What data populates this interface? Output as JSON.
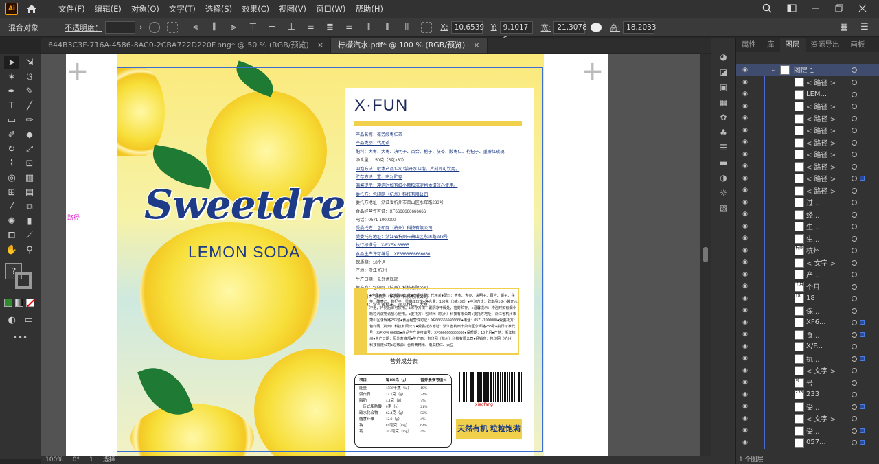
{
  "menu": {
    "logo": "Ai",
    "items": [
      "文件(F)",
      "编辑(E)",
      "对象(O)",
      "文字(T)",
      "选择(S)",
      "效果(C)",
      "视图(V)",
      "窗口(W)",
      "帮助(H)"
    ]
  },
  "control": {
    "object_label": "混合对象",
    "opacity_label": "不透明度：",
    "x_label": "X:",
    "x_value": "10.6539",
    "y_label": "Y:",
    "y_value": "9.1017 c",
    "w_label": "宽:",
    "w_value": "21.3078",
    "h_label": "高:",
    "h_value": "18.2033"
  },
  "tabs": [
    {
      "label": "644B3C3F-716A-4586-8AC0-2CBA722D220F.png* @ 50 % (RGB/预览)",
      "active": false
    },
    {
      "label": "柠檬汽水.pdf* @ 100 % (RGB/预览)",
      "active": true
    }
  ],
  "canvas": {
    "path_label": "路径"
  },
  "design": {
    "headline": "Sweetdream",
    "subheadline": "LEMON SODA",
    "brand": "X·FUN",
    "info": [
      {
        "text": "产品名称：葆芳酸枣仁茶",
        "link": true
      },
      {
        "text": "产品类别：代用茶",
        "link": true
      },
      {
        "text": "配料：大枣、大枣、决明子、百合、栀子、茯苓、酸枣仁、枸杞子、重瓣红玫瑰",
        "link": true
      },
      {
        "text": "净含量：150克（5克×30）",
        "link": false
      },
      {
        "text": "冲泡方法：取本产品1-2小袋开水冲泡，片刻即可饮用。",
        "link": true
      },
      {
        "text": "贮存方法：置、密封贮存",
        "link": true
      },
      {
        "text": "温馨提示：冲泡时如有细小颗粒沉淀物体请放心使用。",
        "link": true
      },
      {
        "text": "委托方：包印网（杭州）科技有限公司",
        "link": true
      },
      {
        "text": "委托方地址：浙江省杭州市萧山区永辉路233号",
        "link": false
      },
      {
        "text": "食品经营许可证：XF6666666666666",
        "link": false
      },
      {
        "text": "电话：0571-1000000",
        "link": false
      },
      {
        "text": "受委托方：包印网（杭州）科技有限公司",
        "link": true
      },
      {
        "text": "受委托方地址：浙江省杭州市萧山区永辉路233号",
        "link": true
      },
      {
        "text": "执行标准号：X/FXFX 66665",
        "link": true
      },
      {
        "text": "食品生产许可编号：XF6666666666666",
        "link": true
      },
      {
        "text": "保质期：18个月",
        "link": false
      },
      {
        "text": "产地：浙江 杭州",
        "link": false
      },
      {
        "text": "生产日期：见外盒底部",
        "link": false
      },
      {
        "text": "生产商：包印网（杭州）科技有限公司",
        "link": false
      },
      {
        "text": "经销商：包印网（杭州）科技有限公司",
        "link": false
      },
      {
        "text": "过敏源：含有黄精米、南瓜籽仁、大豆",
        "link": false
      }
    ],
    "ingredients_block": "●产品名称：葆芳酸枣仁茶●产品类别：代用茶●配料：大枣、大枣、决明子、百合、栀子、茯苓、酸枣仁、枸杞子、重瓣红玫瑰●净含量：150克（5克×30）●冲泡方法：取本品1-2小袋开水冲泡，片刻后即可饮用。●贮存方法：置阴凉干燥处，密封贮存。●温馨提示：冲泡时如有细小颗粒沉淀物请放心使用。●委托方：包印网（杭州）科技有限公司●委托方地址：浙江省杭州市萧山区永辉路233号●食品经营许可证：XF6666666666666●电话：0571-1000000●受委托方：包印网（杭州）科技有限公司●受委托方地址：浙江省杭州市萧山区永辉路233号●执行标准代号：X/FXFX 66665●食品生产许可编号：XF6666666666666●保质期：18个月●产地：浙江杭州●生产日期：见外盒底部●生产商：包印网（杭州）科技有限公司●经销商：包印网（杭州）科技有限公司●过敏源：含有黄精米、南瓜籽仁、大豆",
    "nutrition_title": "营养成分表",
    "nutrition_header": [
      "项目",
      "每100克（g）",
      "营养素参考值%"
    ],
    "nutrition_rows": [
      [
        "能量",
        "1556千焦（kj）",
        "19%"
      ],
      [
        "蛋白质",
        "14.1克（g）",
        "24%"
      ],
      [
        "脂肪",
        "4.1克（g）",
        "7%"
      ],
      [
        "一反式脂肪酸",
        "0克（g）",
        "21%"
      ],
      [
        "碳水化合物",
        "62.4克（g）",
        "52%"
      ],
      [
        "膳食纤维",
        "12.9（g）",
        "4%"
      ],
      [
        "钠",
        "81毫克（mg）",
        "64%"
      ],
      [
        "钙",
        "203毫克（mg）",
        "4%"
      ]
    ],
    "barcode_number": "xiaofang",
    "slogan": "天然有机  粒粒饱满"
  },
  "status": {
    "zoom": "100%",
    "rotation": "0°",
    "page": "1",
    "mode": "选择"
  },
  "layers_panel": {
    "tabs": [
      {
        "label": "属性",
        "active": false
      },
      {
        "label": "库",
        "active": false
      },
      {
        "label": "图层",
        "active": true
      },
      {
        "label": "资源导出",
        "active": false
      },
      {
        "label": "画板",
        "active": false
      }
    ],
    "layer_name": "图层 1",
    "rows": [
      {
        "name": "< 路径 >",
        "thumb": "",
        "sq": false
      },
      {
        "name": "LEM...",
        "thumb": "",
        "sq": false
      },
      {
        "name": "< 路径 >",
        "thumb": "",
        "sq": false
      },
      {
        "name": "< 路径 >",
        "thumb": "",
        "sq": false
      },
      {
        "name": "< 路径 >",
        "thumb": "",
        "sq": false
      },
      {
        "name": "< 路径 >",
        "thumb": "",
        "sq": false
      },
      {
        "name": "< 路径 >",
        "thumb": "",
        "sq": false
      },
      {
        "name": "< 路径 >",
        "thumb": "",
        "sq": false
      },
      {
        "name": "< 路径 >",
        "thumb": "",
        "sq": true
      },
      {
        "name": "< 路径 >",
        "thumb": "",
        "sq": false
      },
      {
        "name": "过...",
        "thumb": "",
        "sq": false
      },
      {
        "name": "经...",
        "thumb": "",
        "sq": false
      },
      {
        "name": "生...",
        "thumb": "",
        "sq": false
      },
      {
        "name": "生...",
        "thumb": "",
        "sq": false
      },
      {
        "name": "杭州",
        "thumb": "杭州",
        "sq": false
      },
      {
        "name": "< 文字 >",
        "thumb": "",
        "sq": false
      },
      {
        "name": "产...",
        "thumb": "",
        "sq": false
      },
      {
        "name": "个月",
        "thumb": "个月",
        "sq": false
      },
      {
        "name": "18",
        "thumb": "18",
        "sq": false
      },
      {
        "name": "保...",
        "thumb": "",
        "sq": false
      },
      {
        "name": "XF6...",
        "thumb": "",
        "sq": true
      },
      {
        "name": "食...",
        "thumb": "",
        "sq": true
      },
      {
        "name": "X/F...",
        "thumb": "",
        "sq": false
      },
      {
        "name": "执...",
        "thumb": "",
        "sq": true
      },
      {
        "name": "< 文字 >",
        "thumb": "",
        "sq": false
      },
      {
        "name": "号",
        "thumb": "号",
        "sq": false
      },
      {
        "name": "233",
        "thumb": "233",
        "sq": false
      },
      {
        "name": "受...",
        "thumb": "",
        "sq": true
      },
      {
        "name": "< 文字 >",
        "thumb": "",
        "sq": false
      },
      {
        "name": "受...",
        "thumb": "",
        "sq": true
      },
      {
        "name": "057...",
        "thumb": "",
        "sq": true
      }
    ],
    "footer": "1 个图层"
  }
}
